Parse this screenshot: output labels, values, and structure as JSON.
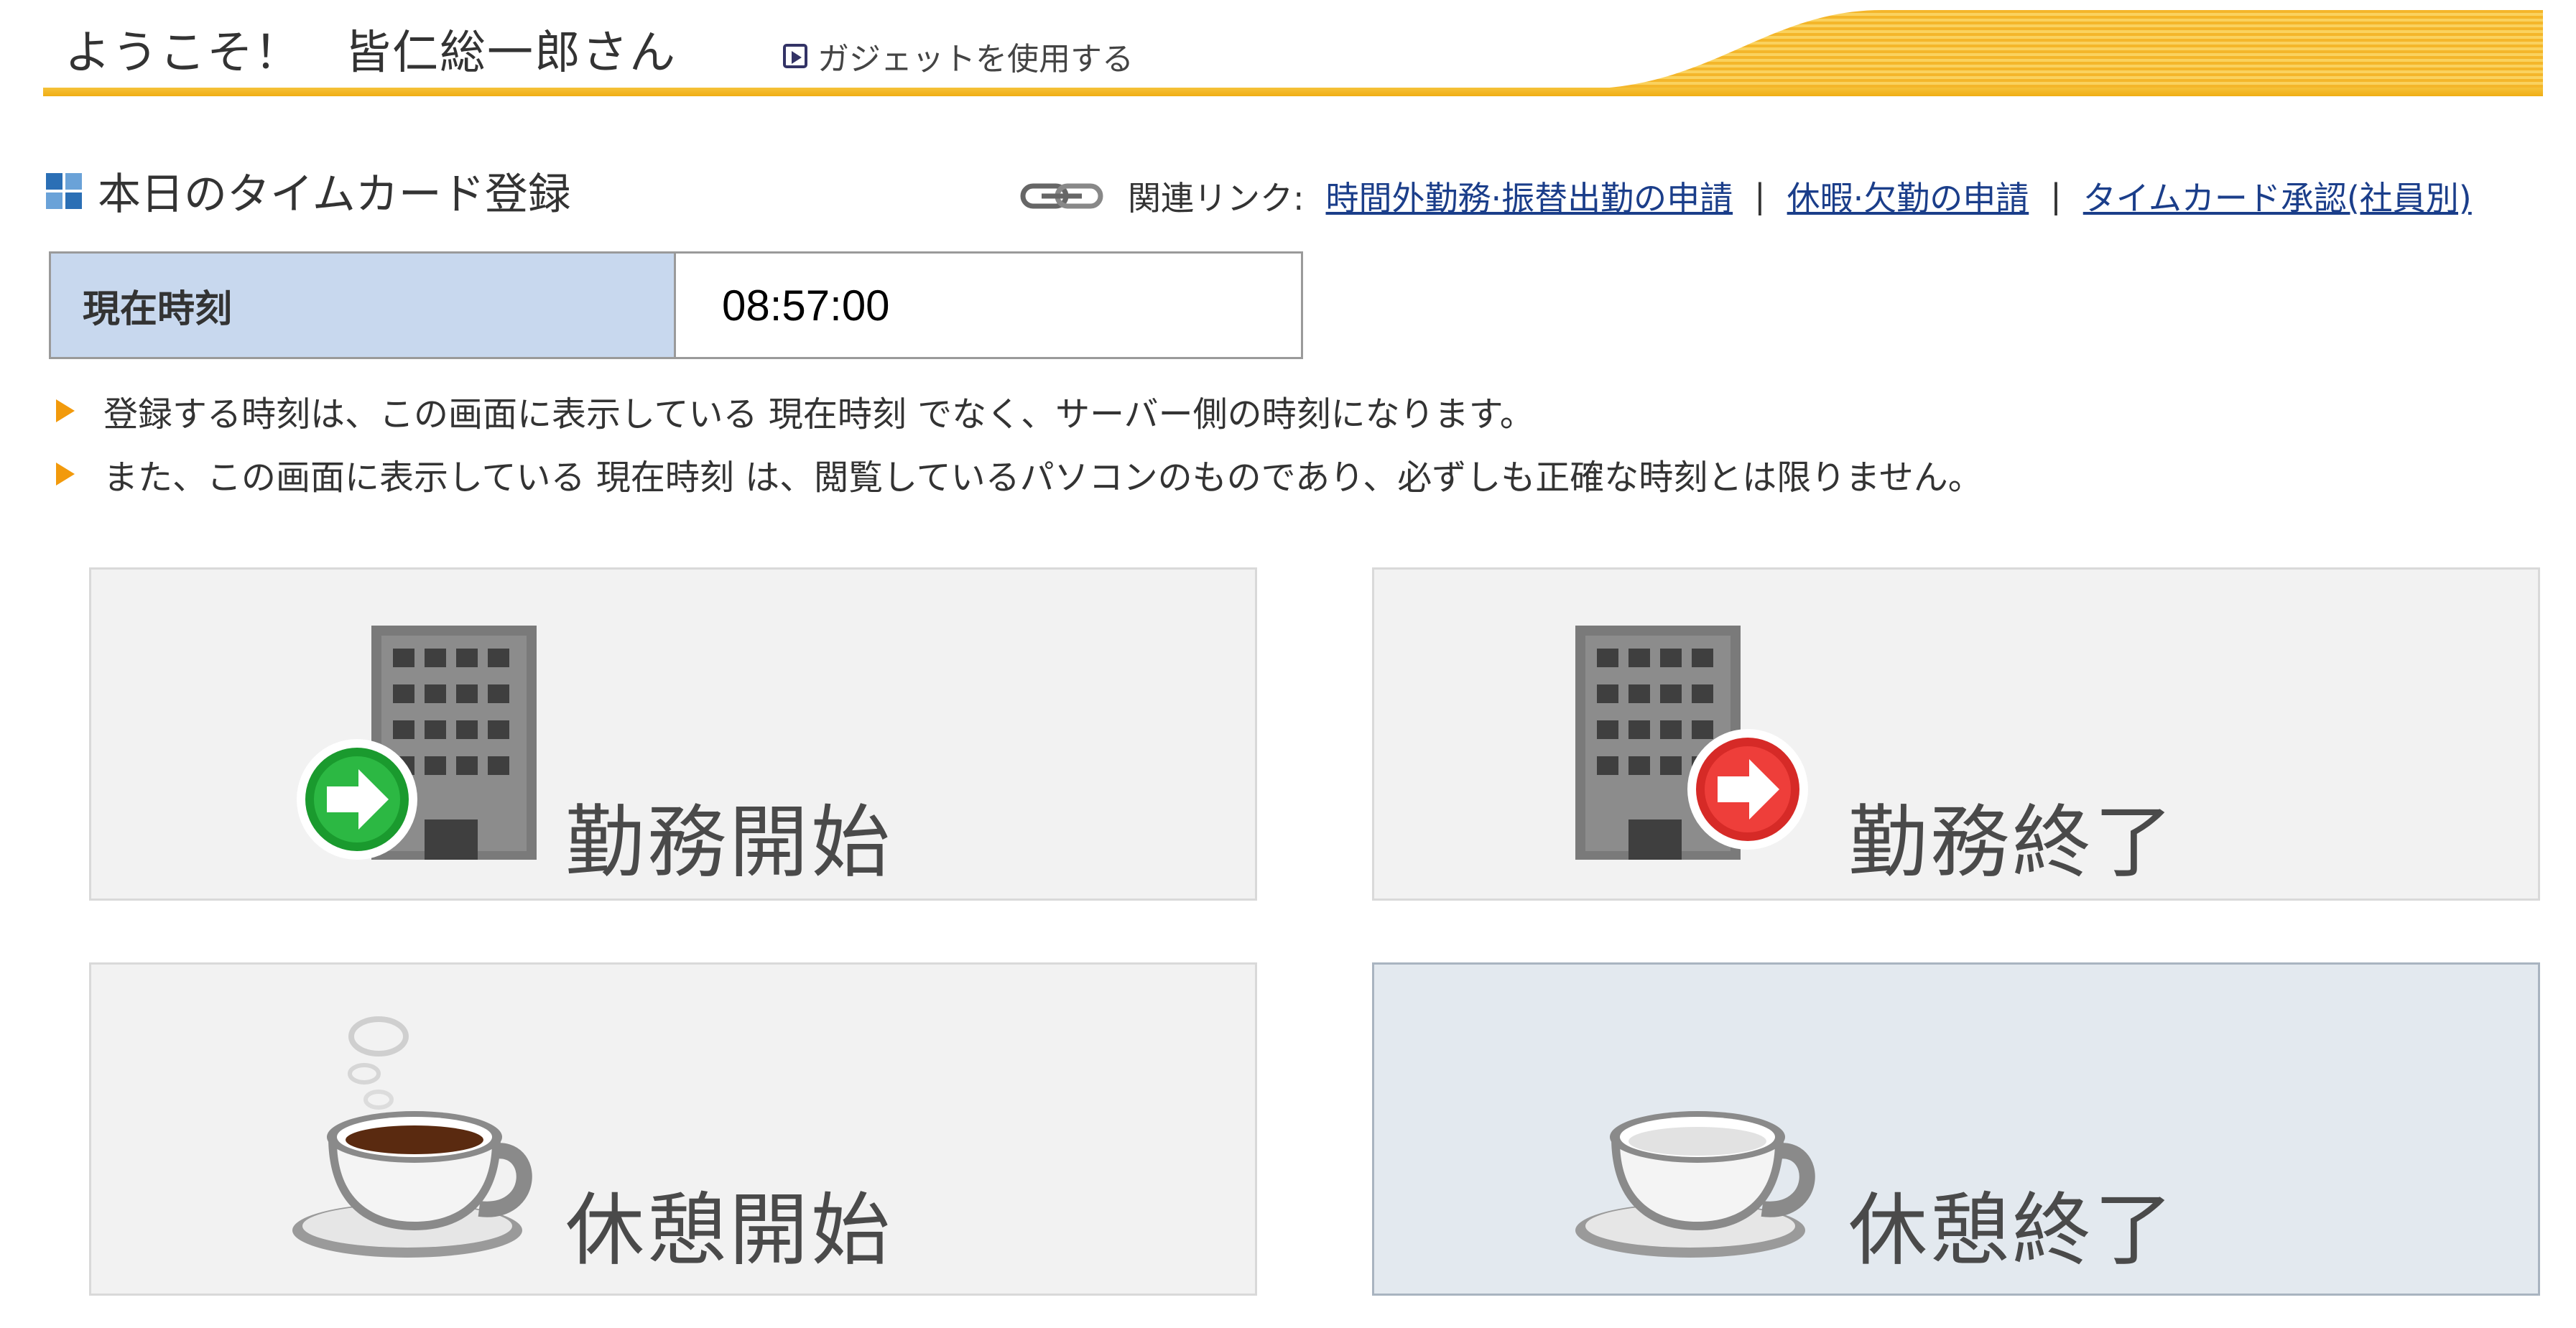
{
  "header": {
    "welcome_prefix": "ようこそ！",
    "user_name": "皆仁総一郎さん",
    "gadget_link": "ガジェットを使用する"
  },
  "section": {
    "title": "本日のタイムカード登録"
  },
  "related_links": {
    "label": "関連リンク:",
    "items": [
      {
        "label": "時間外勤務·振替出勤の申請"
      },
      {
        "label": "休暇·欠勤の申請"
      },
      {
        "label": "タイムカード承認(社員別)"
      }
    ],
    "separator": "|"
  },
  "current_time": {
    "label": "現在時刻",
    "value": "08:57:00"
  },
  "notes": [
    "登録する時刻は、この画面に表示している 現在時刻 でなく、サーバー側の時刻になります。",
    "また、この画面に表示している 現在時刻 は、閲覧しているパソコンのものであり、必ずしも正確な時刻とは限りません。"
  ],
  "buttons": {
    "work_start": {
      "label": "勤務開始",
      "icon": "building-arrow-in-icon",
      "arrow_color": "#1a9a2e"
    },
    "work_end": {
      "label": "勤務終了",
      "icon": "building-arrow-out-icon",
      "arrow_color": "#e8322f"
    },
    "break_start": {
      "label": "休憩開始",
      "icon": "coffee-cup-steaming-icon"
    },
    "break_end": {
      "label": "休憩終了",
      "icon": "empty-cup-icon"
    }
  },
  "colors": {
    "header_accent": "#f0ad14",
    "link": "#1b3e8a",
    "time_label_bg": "#c8d8ee",
    "note_marker": "#f29a0c",
    "active_button_bg": "#e3e9ef"
  }
}
